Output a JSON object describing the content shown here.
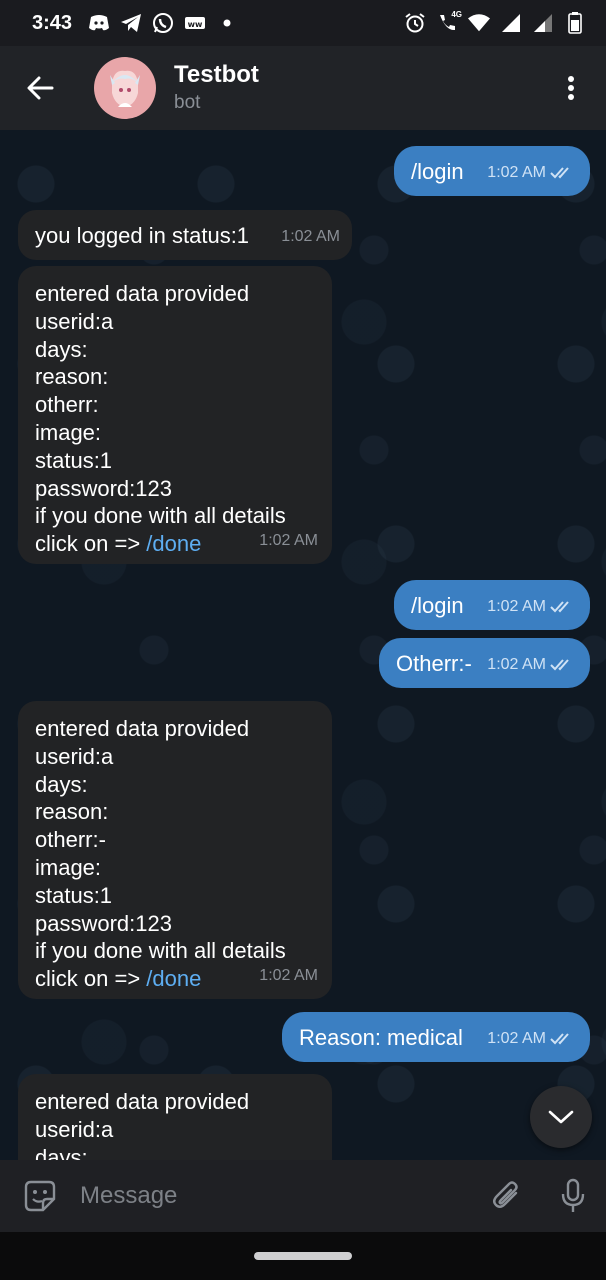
{
  "status_bar": {
    "time": "3:43",
    "network_badge": "4G",
    "left_icons": [
      "discord-icon",
      "telegram-icon",
      "whatsapp-icon",
      "app-icon",
      "dot-icon"
    ],
    "right_icons": [
      "alarm-icon",
      "call-icon",
      "wifi-icon",
      "signal-icon",
      "signal-icon",
      "battery-icon"
    ]
  },
  "header": {
    "title": "Testbot",
    "subtitle": "bot"
  },
  "messages": [
    {
      "dir": "out",
      "text": "/login",
      "time": "1:02 AM"
    },
    {
      "dir": "in",
      "text": "you logged in status:1",
      "time": "1:02 AM"
    },
    {
      "dir": "in",
      "text": "entered data provided\nuserid:a\ndays:\nreason:\notherr:\nimage:\nstatus:1\npassword:123\nif you done with all details\nclick on => ",
      "link": "/done",
      "time": "1:02 AM"
    },
    {
      "dir": "out",
      "text": "/login",
      "time": "1:02 AM"
    },
    {
      "dir": "out",
      "text": "Otherr:-",
      "time": "1:02 AM"
    },
    {
      "dir": "in",
      "text": "entered data provided\nuserid:a\ndays:\nreason:\notherr:-\nimage:\nstatus:1\npassword:123\nif you done with all details\nclick on => ",
      "link": "/done",
      "time": "1:02 AM"
    },
    {
      "dir": "out",
      "text": "Reason: medical",
      "time": "1:02 AM"
    },
    {
      "dir": "in",
      "text": "entered data provided\nuserid:a\ndays:",
      "time": ""
    }
  ],
  "input": {
    "placeholder": "Message"
  },
  "colors": {
    "incoming_bubble": "#222325",
    "outgoing_bubble": "#3b7fc2",
    "link": "#5eaef2",
    "header": "#212327"
  }
}
